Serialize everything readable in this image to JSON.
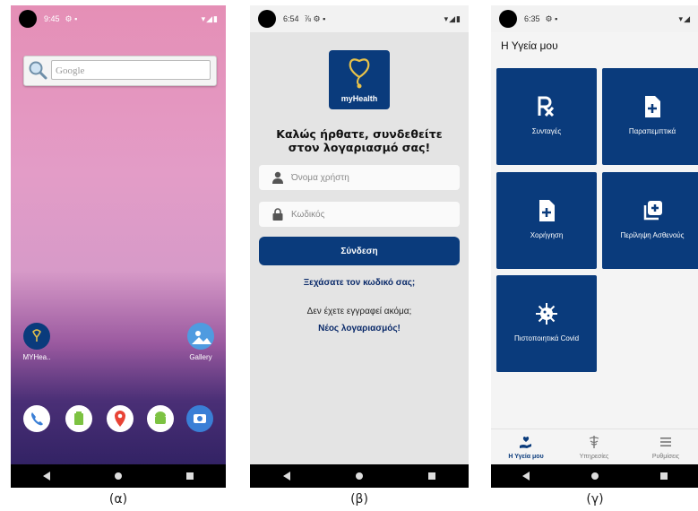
{
  "panel_a": {
    "caption": "(α)",
    "status_time": "9:45",
    "status_right": "▾◢▮",
    "search_placeholder": "Google",
    "apps": [
      {
        "label": "MYHea.."
      },
      {
        "label": "Gallery"
      }
    ],
    "colors": {
      "wallpaper_top": "#e58fb6",
      "wallpaper_bottom": "#2a1e5e"
    }
  },
  "panel_b": {
    "caption": "(β)",
    "status_time": "6:54",
    "status_right": "▾◢▮",
    "logo_text": "myHealth",
    "welcome": "Καλώς ήρθατε, συνδεθείτε στον λογαριασμό σας!",
    "username_placeholder": "Όνομα χρήστη",
    "password_placeholder": "Κωδικός",
    "login_label": "Σύνδεση",
    "forgot_label": "Ξεχάσατε τον κωδικό σας;",
    "not_registered": "Δεν έχετε εγγραφεί ακόμα;",
    "new_account": "Νέος λογαριασμός!",
    "colors": {
      "accent": "#0a3b7c"
    }
  },
  "panel_c": {
    "caption": "(γ)",
    "status_time": "6:35",
    "status_right": "▾◢",
    "title": "Η Υγεία μου",
    "tiles": [
      {
        "label": "Συνταγές",
        "icon": "rx-icon"
      },
      {
        "label": "Παραπεμπτικά",
        "icon": "document-plus-icon"
      },
      {
        "label": "Χορήγηση",
        "icon": "document-plus-icon"
      },
      {
        "label": "Περίληψη Ασθενούς",
        "icon": "copy-plus-icon"
      },
      {
        "label": "Πιστοποιητικά Covid",
        "icon": "virus-icon"
      }
    ],
    "bottom_nav": [
      {
        "label": "Η Υγεία μου",
        "active": true
      },
      {
        "label": "Υπηρεσίες",
        "active": false
      },
      {
        "label": "Ρυθμίσεις",
        "active": false
      }
    ],
    "colors": {
      "tile": "#0a3b7c"
    }
  }
}
